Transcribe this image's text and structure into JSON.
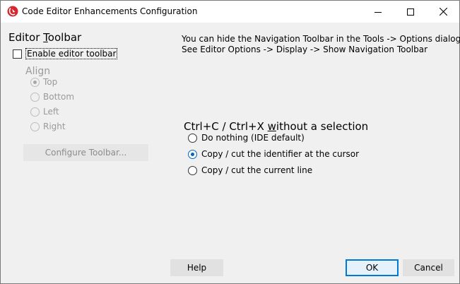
{
  "window": {
    "title": "Code Editor Enhancements Configuration",
    "icon": "app-logo-icon",
    "controls": [
      "minimize-icon",
      "maximize-icon",
      "close-icon"
    ]
  },
  "editor_toolbar": {
    "group_title_pre": "Editor ",
    "group_title_ul": "T",
    "group_title_post": "oolbar",
    "enable_label": "Enable editor toolbar",
    "enable_checked": false,
    "align_title": "Align",
    "align_options": [
      "Top",
      "Bottom",
      "Left",
      "Right"
    ],
    "align_selected": "Top",
    "configure_button": "Configure Toolbar..."
  },
  "info": {
    "line1": "You can hide the Navigation Toolbar in the Tools -> Options dialog",
    "line2": "See Editor Options -> Display -> Show Navigation Toolbar"
  },
  "selection": {
    "title_pre": "Ctrl+C / Ctrl+X ",
    "title_ul": "w",
    "title_post": "ithout a selection",
    "options": [
      "Do nothing (IDE default)",
      "Copy / cut the identifier at the cursor",
      "Copy / cut the current line"
    ],
    "selected": "Copy / cut the identifier at the cursor"
  },
  "footer": {
    "help": "Help",
    "ok": "OK",
    "cancel": "Cancel"
  },
  "colors": {
    "accent": "#0078d7",
    "radio_dot": "#0067c0",
    "disabled_text": "#9a9a9a"
  }
}
